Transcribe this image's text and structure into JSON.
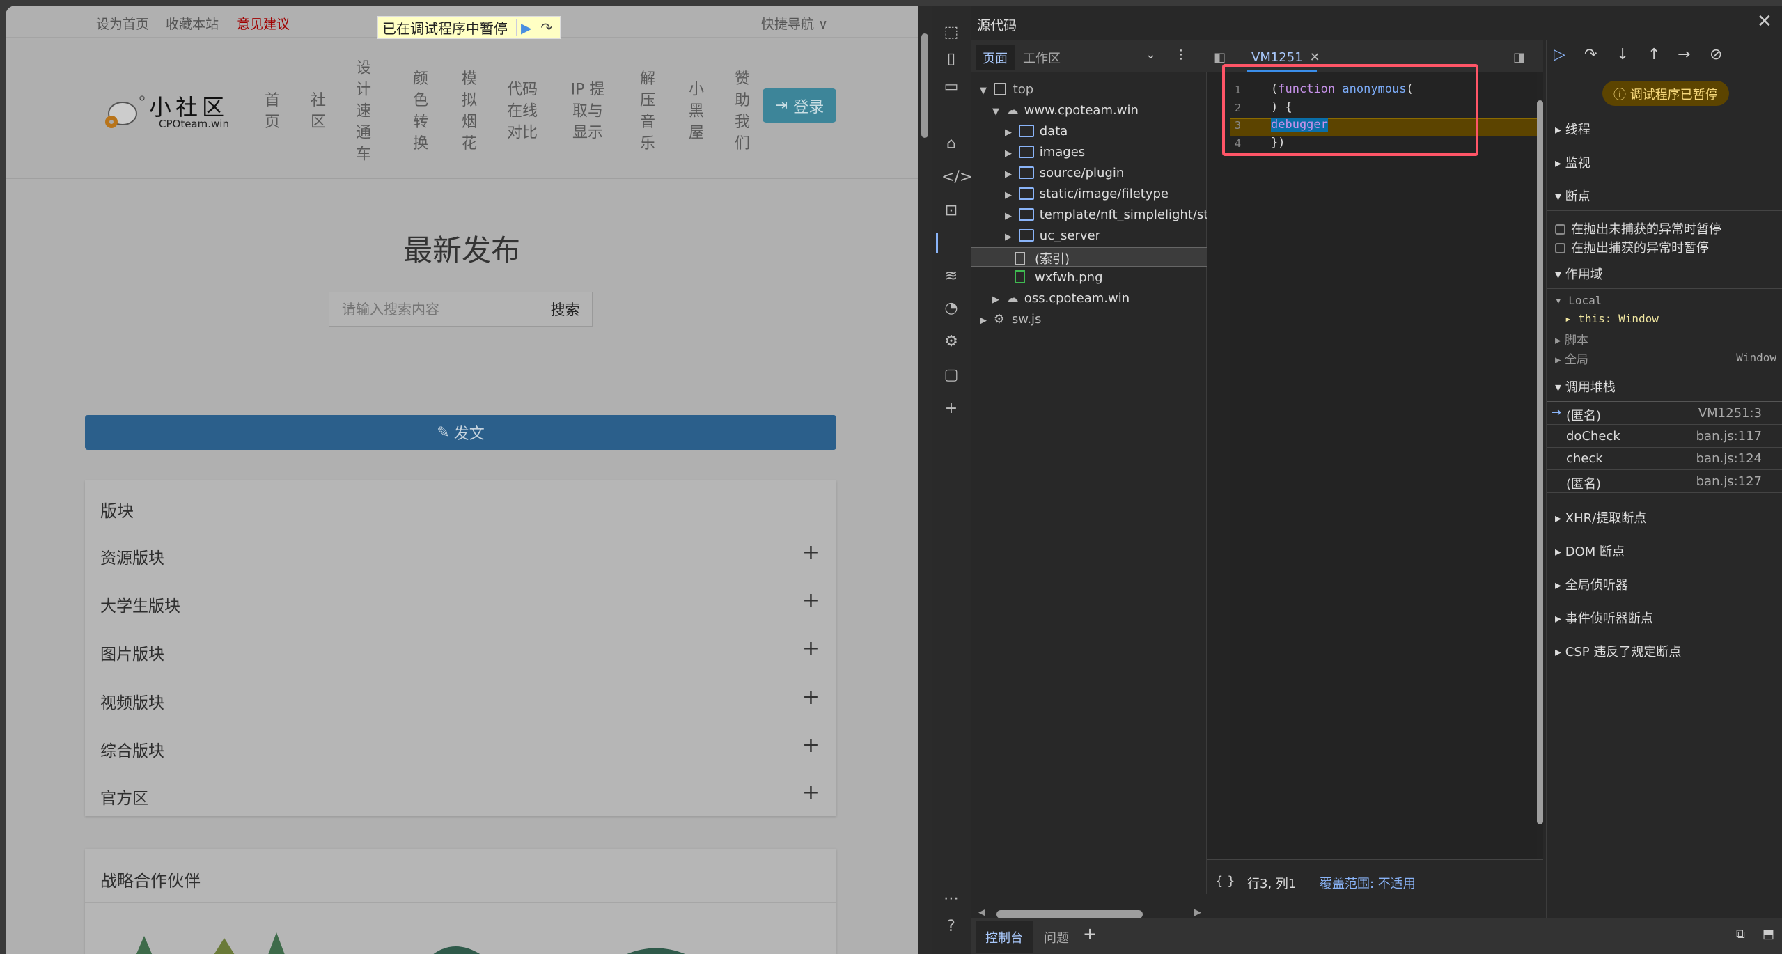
{
  "page": {
    "topbar": {
      "set_home": "设为首页",
      "bookmark": "收藏本站",
      "feedback": "意见建议",
      "quick_nav": "快捷导航 ∨"
    },
    "pause_banner": {
      "text": "已在调试程序中暂停"
    },
    "logo": {
      "title": "小社区",
      "subtitle": "CPOteam.win"
    },
    "nav": [
      "首页",
      "社区",
      "设计速通车",
      "颜色转换",
      "模拟烟花",
      "代码在线对比",
      "IP 提取与显示",
      "解压音乐",
      "小黑屋",
      "赞助我们"
    ],
    "login": "登录",
    "section_title": "最新发布",
    "search": {
      "placeholder": "请输入搜索内容",
      "button": "搜索"
    },
    "post_button": "发文",
    "boards": {
      "title": "版块",
      "items": [
        "资源版块",
        "大学生版块",
        "图片版块",
        "视频版块",
        "综合版块",
        "官方区"
      ]
    },
    "partners": {
      "title": "战略合作伙伴"
    }
  },
  "devtools": {
    "title": "源代码",
    "nav_tabs": [
      "页面",
      "工作区"
    ],
    "tree": [
      {
        "label": "top",
        "depth": 0,
        "type": "frame",
        "open": true
      },
      {
        "label": "www.cpoteam.win",
        "depth": 1,
        "type": "cloud",
        "open": true
      },
      {
        "label": "data",
        "depth": 2,
        "type": "folder"
      },
      {
        "label": "images",
        "depth": 2,
        "type": "folder"
      },
      {
        "label": "source/plugin",
        "depth": 2,
        "type": "folder"
      },
      {
        "label": "static/image/filetype",
        "depth": 2,
        "type": "folder"
      },
      {
        "label": "template/nft_simplelight/stat",
        "depth": 2,
        "type": "folder"
      },
      {
        "label": "uc_server",
        "depth": 2,
        "type": "folder"
      },
      {
        "label": "(索引)",
        "depth": 2,
        "type": "file",
        "selected": true
      },
      {
        "label": "wxfwh.png",
        "depth": 2,
        "type": "image"
      },
      {
        "label": "oss.cpoteam.win",
        "depth": 1,
        "type": "cloud"
      },
      {
        "label": "sw.js",
        "depth": 0,
        "type": "worker"
      }
    ],
    "editor_tab": "VM1251",
    "code": [
      {
        "n": "1",
        "kw": "(function",
        "name": " anonymous(",
        "rest": ""
      },
      {
        "n": "2",
        "kw": "",
        "name": "",
        "rest": ") {"
      },
      {
        "n": "3",
        "kw": "",
        "name": "",
        "rest": "debugger"
      },
      {
        "n": "4",
        "kw": "",
        "name": "",
        "rest": "})"
      }
    ],
    "status": {
      "braces": "{ }",
      "position": "行3, 列1",
      "coverage": "覆盖范围: 不适用"
    },
    "paused_badge": "调试程序已暂停",
    "sections": {
      "threads": "线程",
      "watch": "监视",
      "breakpoints": "断点",
      "scope": "作用域",
      "callstack": "调用堆栈",
      "xhr": "XHR/提取断点",
      "dom": "DOM 断点",
      "global_listeners": "全局侦听器",
      "event_bp": "事件侦听器断点",
      "csp": "CSP 违反了规定断点"
    },
    "bp_options": [
      "在抛出未捕获的异常时暂停",
      "在抛出捕获的异常时暂停"
    ],
    "scope": {
      "local": "Local",
      "this_key": "this:",
      "this_val": "Window",
      "script": "脚本",
      "global": "全局",
      "global_val": "Window"
    },
    "callstack": [
      {
        "name": "(匿名)",
        "file": "VM1251:3",
        "current": true
      },
      {
        "name": "doCheck",
        "file": "ban.js:117"
      },
      {
        "name": "check",
        "file": "ban.js:124"
      },
      {
        "name": "(匿名)",
        "file": "ban.js:127"
      }
    ],
    "drawer_tabs": [
      "控制台",
      "问题"
    ],
    "colors": {
      "accent": "#8ab4f8",
      "paused_line": "#5c4400",
      "highlight_box": "#ff5567"
    }
  }
}
